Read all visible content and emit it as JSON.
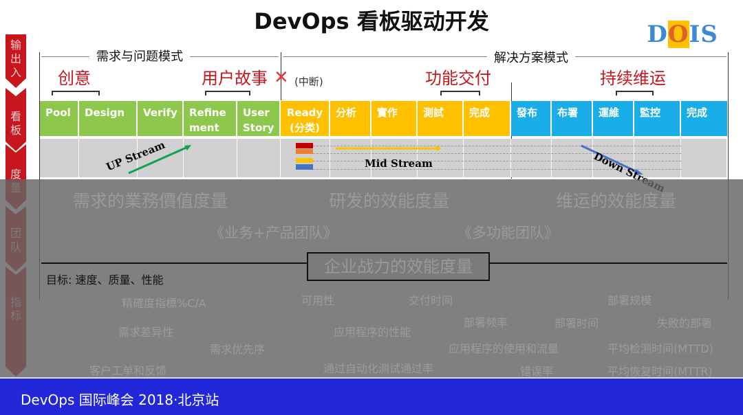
{
  "title": "DevOps 看板驱动开发",
  "logo": {
    "d": "D",
    "o": "O",
    "is": "IS"
  },
  "side": [
    "输出入",
    "看板",
    "度量",
    "团队",
    "指标"
  ],
  "sections": {
    "left": "需求与问题模式",
    "right": "解决方案模式"
  },
  "labels": {
    "idea": "创意",
    "story": "用户故事",
    "interrupt": "(中断)",
    "delivery": "功能交付",
    "ops": "持续维运"
  },
  "columns": {
    "green": [
      "Pool",
      "Design",
      "Verify",
      "Refine ment",
      "User Story"
    ],
    "orange": [
      "Ready (分类)",
      "分析",
      "實作",
      "測試",
      "完成"
    ],
    "blue": [
      "發布",
      "布署",
      "運維",
      "監控",
      "完成"
    ]
  },
  "colors": {
    "green": "#8dc84c",
    "orange": "#ffc000",
    "blue": "#1aaee8",
    "red": "#c8161d",
    "footer": "#2228d9"
  },
  "streams": {
    "up": "UP Stream",
    "mid": "Mid Stream",
    "down": "Down Stream"
  },
  "measures": [
    "需求的業務價值度量",
    "研发的效能度量",
    "维运的效能度量"
  ],
  "teams": [
    "《业务+产品团队》",
    "《多功能团队》"
  ],
  "enterprise": "企业战力的效能度量",
  "goal": "目标: 速度、质量、性能",
  "metrics": [
    "精確度指標%C/A",
    "可用性",
    "交付时间",
    "部署规模",
    "部署频率",
    "部署时间",
    "失败的部署",
    "需求差异性",
    "应用程序的性能",
    "需求优先序",
    "应用程序的使用和流量",
    "平均检测时间(MTTD)",
    "客户工单和反馈",
    "通过自动化测试通过率",
    "错误率",
    "平均恢复时间(MTTR)"
  ],
  "footer": "DevOps 国际峰会 2018·北京站"
}
